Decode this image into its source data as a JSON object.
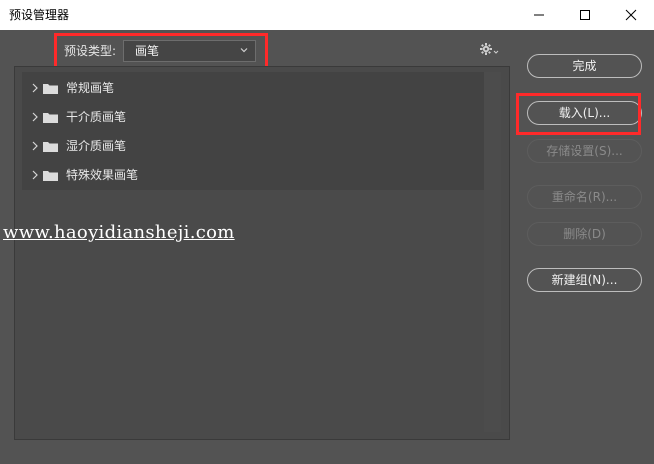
{
  "window": {
    "title": "预设管理器"
  },
  "preset": {
    "type_label": "预设类型:",
    "type_value": "画笔"
  },
  "list": {
    "items": [
      {
        "label": "常规画笔"
      },
      {
        "label": "干介质画笔"
      },
      {
        "label": "湿介质画笔"
      },
      {
        "label": "特殊效果画笔"
      }
    ]
  },
  "buttons": {
    "done": "完成",
    "load": "载入(L)...",
    "save": "存储设置(S)...",
    "rename": "重命名(R)...",
    "delete": "删除(D)",
    "new_group": "新建组(N)..."
  },
  "watermark": "www.haoyidianshejі.com",
  "colors": {
    "highlight": "#ff2a2a",
    "background": "#535353"
  }
}
